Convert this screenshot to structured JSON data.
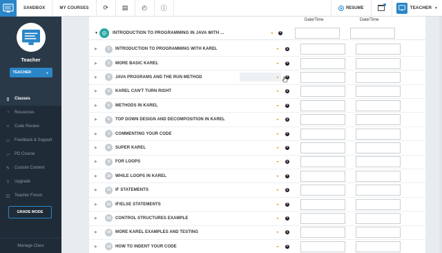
{
  "topbar": {
    "sandbox": "SANDBOX",
    "my_courses": "MY COURSES",
    "resume": "RESUME",
    "user_role": "TEACHER"
  },
  "sidebar": {
    "profile_name": "Teacher",
    "role_button": "TEACHER",
    "items": [
      {
        "label": "Classes",
        "icon": "book-icon"
      },
      {
        "label": "Resources",
        "icon": "lightbulb-icon"
      },
      {
        "label": "Code Review",
        "icon": "code-icon"
      },
      {
        "label": "Feedback & Support",
        "icon": "chat-icon"
      },
      {
        "label": "PD Course",
        "icon": "folder-icon"
      },
      {
        "label": "Custom Content",
        "icon": "pencil-icon"
      },
      {
        "label": "Upgrade",
        "icon": "arrow-up-icon"
      },
      {
        "label": "Teacher Forum",
        "icon": "forum-icon"
      }
    ],
    "grade_mode": "GRADE MODE",
    "manage_class": "Manage Class"
  },
  "table": {
    "col1": "Date/Time",
    "col2": "Date/Time",
    "unit": {
      "title": "INTRODUCTION TO PROGRAMMING IN JAVA WITH ..."
    },
    "lessons": [
      {
        "num": "1",
        "title": "INTRODUCTION TO PROGRAMMING WITH KAREL"
      },
      {
        "num": "2",
        "title": "MORE BASIC KAREL"
      },
      {
        "num": "3",
        "title": "JAVA PROGRAMS AND THE RUN METHOD"
      },
      {
        "num": "4",
        "title": "KAREL CAN'T TURN RIGHT"
      },
      {
        "num": "5",
        "title": "METHODS IN KAREL"
      },
      {
        "num": "6",
        "title": "TOP DOWN DESIGN AND DECOMPOSITION IN KAREL"
      },
      {
        "num": "7",
        "title": "COMMENTING YOUR CODE"
      },
      {
        "num": "8",
        "title": "SUPER KAREL"
      },
      {
        "num": "9",
        "title": "FOR LOOPS"
      },
      {
        "num": "10",
        "title": "WHILE LOOPS IN KAREL"
      },
      {
        "num": "11",
        "title": "IF STATEMENTS"
      },
      {
        "num": "12",
        "title": "IF/ELSE STATEMENTS"
      },
      {
        "num": "13",
        "title": "CONTROL STRUCTURES EXAMPLE"
      },
      {
        "num": "14",
        "title": "MORE KAREL EXAMPLES AND TESTING"
      },
      {
        "num": "15",
        "title": "HOW TO INDENT YOUR CODE"
      }
    ]
  },
  "colors": {
    "accent": "#2a86c7",
    "teal": "#2aa7a0",
    "sidebar": "#1f2c38",
    "caret": "#f0a020"
  }
}
